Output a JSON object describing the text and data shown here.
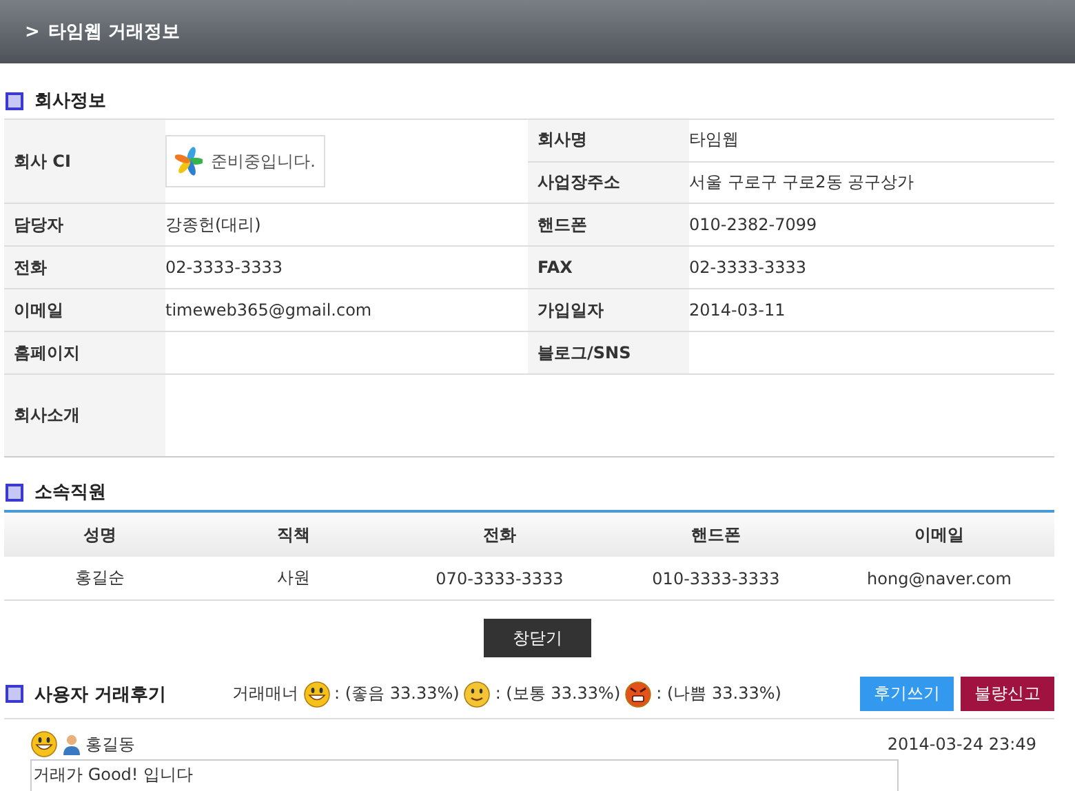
{
  "header": {
    "arrow": ">",
    "title": "타임웹 거래정보"
  },
  "company": {
    "title": "회사정보",
    "ci": {
      "label": "회사 CI",
      "text": "준비중입니다."
    },
    "ci_fields": [
      {
        "label": "회사명",
        "value": "타임웹"
      },
      {
        "label": "사업장주소",
        "value": "서울 구로구 구로2동 공구상가"
      }
    ],
    "rows": [
      [
        {
          "label": "담당자",
          "value": "강종헌(대리)"
        },
        {
          "label": "핸드폰",
          "value": "010-2382-7099"
        }
      ],
      [
        {
          "label": "전화",
          "value": "02-3333-3333"
        },
        {
          "label": "FAX",
          "value": "02-3333-3333"
        }
      ],
      [
        {
          "label": "이메일",
          "value": "timeweb365@gmail.com"
        },
        {
          "label": "가입일자",
          "value": "2014-03-11"
        }
      ],
      [
        {
          "label": "홈페이지"
        },
        {
          "label": "블로그/SNS"
        }
      ]
    ],
    "intro": {
      "label": "회사소개"
    }
  },
  "staff": {
    "title": "소속직원",
    "columns": [
      "성명",
      "직책",
      "전화",
      "핸드폰",
      "이메일"
    ],
    "rows": [
      [
        "홍길순",
        "사원",
        "070-3333-3333",
        "010-3333-3333",
        "hong@naver.com"
      ]
    ]
  },
  "close_button": "창닫기",
  "reviews": {
    "title": "사용자 거래후기",
    "manner_label": "거래매너",
    "ratings": [
      {
        "kind": "good",
        "text": ": (좋음 33.33%)"
      },
      {
        "kind": "normal",
        "text": ": (보통 33.33%)"
      },
      {
        "kind": "bad",
        "text": ": (나쁨 33.33%)"
      }
    ],
    "buttons": [
      {
        "label": "후기쓰기",
        "color": "#3399ee"
      },
      {
        "label": "불량신고",
        "color": "#a0123f"
      }
    ],
    "entries": [
      {
        "kind": "good",
        "author": "홍길동",
        "date": "2014-03-24 23:49",
        "text": "거래가 Good! 입니다"
      }
    ]
  }
}
